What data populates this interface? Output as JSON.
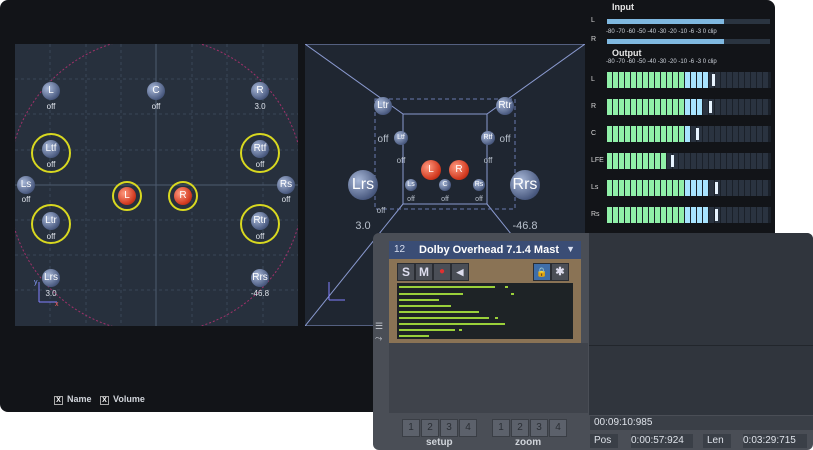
{
  "panner": {
    "speakers2d": [
      {
        "id": "L",
        "name": "L",
        "value": "off"
      },
      {
        "id": "C",
        "name": "C",
        "value": "off"
      },
      {
        "id": "R",
        "name": "R",
        "value": "3.0"
      },
      {
        "id": "Ltf",
        "name": "Ltf",
        "value": "off"
      },
      {
        "id": "Rtf",
        "name": "Rtf",
        "value": "off"
      },
      {
        "id": "Ls",
        "name": "Ls",
        "value": "off"
      },
      {
        "id": "Rs",
        "name": "Rs",
        "value": "off"
      },
      {
        "id": "Ltr",
        "name": "Ltr",
        "value": "off"
      },
      {
        "id": "Rtr",
        "name": "Rtr",
        "value": "off"
      },
      {
        "id": "Lrs",
        "name": "Lrs",
        "value": "3.0"
      },
      {
        "id": "Rrs",
        "name": "Rrs",
        "value": "-46.8"
      }
    ],
    "sources2d": [
      "L",
      "R"
    ],
    "view3d": {
      "Ltr": "Ltr",
      "Rtr": "Rtr",
      "Ltf": "Ltf",
      "Rtf": "Rtf",
      "Lrs": "Lrs",
      "Rrs": "Rrs",
      "Ls": "Ls",
      "Rs": "Rs",
      "C": "C",
      "L": "L",
      "R": "R",
      "values": [
        "off",
        "off",
        "off",
        "off",
        "off",
        "off",
        "off",
        "off",
        "3.0",
        "-46.8"
      ]
    },
    "checkboxes": [
      {
        "mark": "X",
        "label": "Name"
      },
      {
        "mark": "X",
        "label": "Volume"
      }
    ],
    "axis": {
      "x": "x",
      "y": "y"
    }
  },
  "meters": {
    "input_title": "Input",
    "output_title": "Output",
    "scale": "-80  -70  -60  -50  -40  -30  -20  -10   -6    -3   0   clip",
    "input_channels": [
      {
        "label": "L",
        "level": 0.72
      },
      {
        "label": "R",
        "level": 0.72
      }
    ],
    "output_channels": [
      {
        "label": "L",
        "green": 0.46,
        "blue": 0.14,
        "peak": 0.64
      },
      {
        "label": "R",
        "green": 0.46,
        "blue": 0.12,
        "peak": 0.62
      },
      {
        "label": "C",
        "green": 0.46,
        "blue": 0.05,
        "peak": 0.54
      },
      {
        "label": "LFE",
        "green": 0.37,
        "blue": 0.0,
        "peak": 0.39
      },
      {
        "label": "Ls",
        "green": 0.46,
        "blue": 0.16,
        "peak": 0.66
      },
      {
        "label": "Rs",
        "green": 0.46,
        "blue": 0.16,
        "peak": 0.66
      }
    ]
  },
  "track": {
    "number": "12",
    "name": "Dolby Overhead 7.1.4 Mast",
    "arrow": "▼",
    "buttons": {
      "solo": "S",
      "mute": "M",
      "record": "●",
      "monitor": "◀",
      "lock": "🔒",
      "fx": "✱"
    }
  },
  "footer": {
    "setup_buttons": [
      "1",
      "2",
      "3",
      "4"
    ],
    "setup_label": "setup",
    "zoom_buttons": [
      "1",
      "2",
      "3",
      "4"
    ],
    "zoom_label": "zoom",
    "cursor_time": "00:09:10:985",
    "pos_label": "Pos",
    "pos_value": "0:00:57:924",
    "len_label": "Len",
    "len_value": "0:03:29:715"
  },
  "colors": {
    "window_bg": "#121418",
    "panel_bg": "#27303d",
    "ring": "#d8d820",
    "source": "#d23a20",
    "meter_green": "#90f0a8",
    "meter_blue": "#a8e4ff",
    "meter_led": "#9ad03a",
    "track_header": "#3a4d75",
    "track_body": "#8a7355"
  }
}
